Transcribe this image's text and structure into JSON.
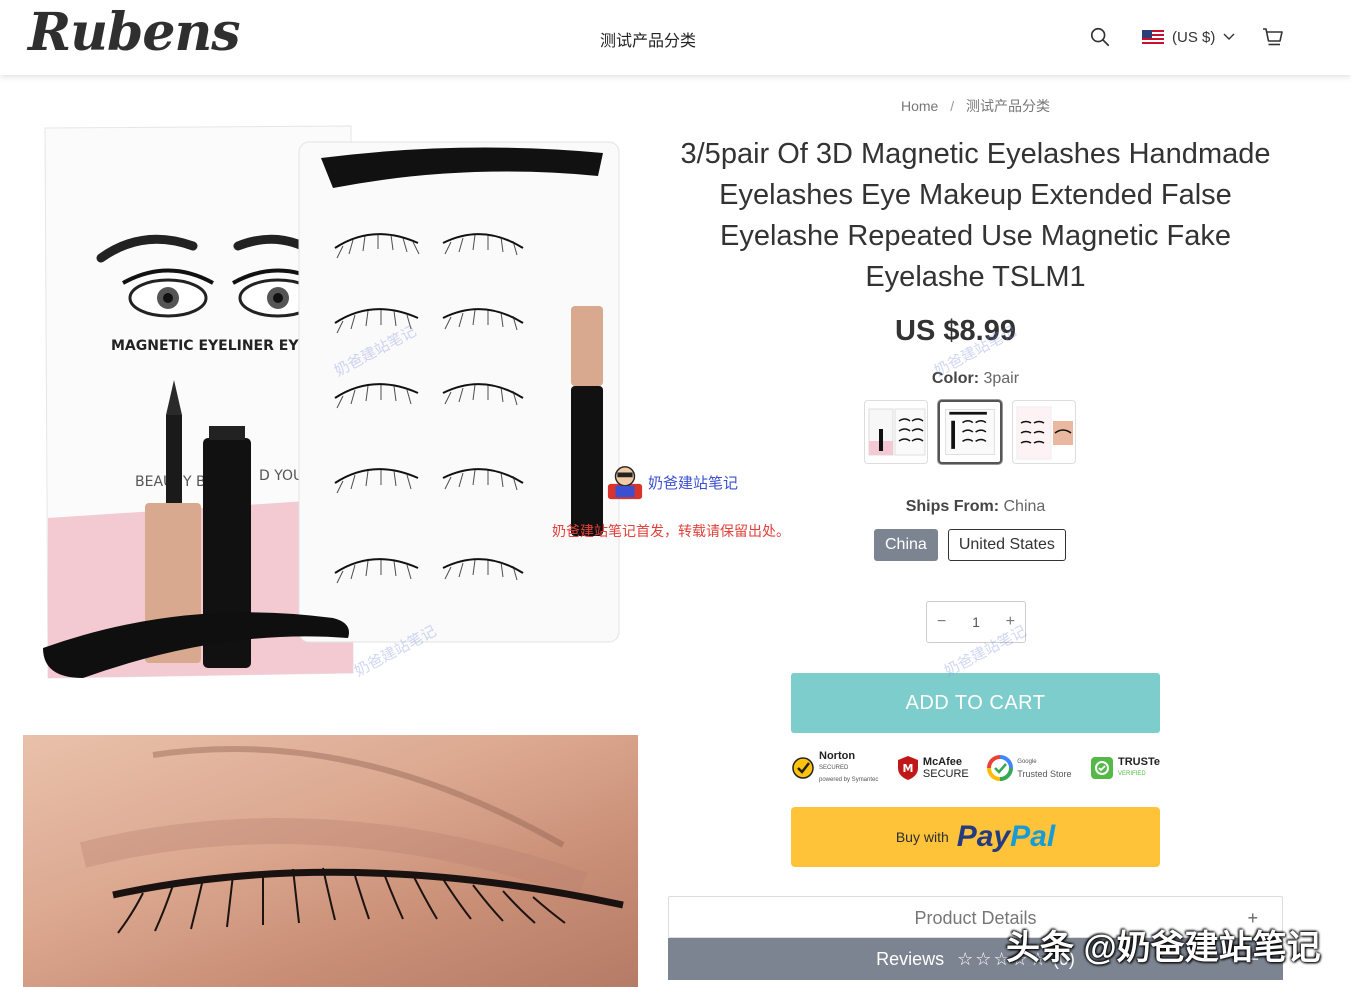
{
  "header": {
    "logo": "Rubens",
    "nav_category": "测试产品分类",
    "currency": "(US $)"
  },
  "breadcrumb": {
    "home": "Home",
    "sep": "/",
    "current": "测试产品分类"
  },
  "product": {
    "title": "3/5pair Of 3D Magnetic Eyelashes Handmade Eyelashes Eye Makeup Extended False Eyelashe Repeated Use Magnetic Fake Eyelashe TSLM1",
    "price": "US $8.99",
    "color_label": "Color:",
    "color_value": "3pair",
    "ships_label": "Ships From:",
    "ships_value": "China",
    "ship_options": [
      "China",
      "United States"
    ],
    "quantity": "1",
    "qty_minus": "−",
    "qty_plus": "+",
    "add_to_cart": "ADD TO CART",
    "paypal_buy_with": "Buy with",
    "paypal_a": "Pay",
    "paypal_b": "Pal",
    "product_details": "Product Details",
    "details_toggle": "+",
    "reviews": "Reviews",
    "review_stars": "☆☆☆☆☆",
    "review_count": "(0)",
    "review_toggle": "−"
  },
  "trust_badges": [
    {
      "name": "Norton",
      "sub": "SECURED",
      "sub2": "powered by Symantec"
    },
    {
      "name": "McAfee",
      "sub": "SECURE"
    },
    {
      "name": "Google",
      "sub": "Trusted Store"
    },
    {
      "name": "TRUSTe",
      "sub": "VERIFIED"
    }
  ],
  "product_image": {
    "box_text": "MAGNETIC EYELINER EYELASH SE",
    "box_tagline_a": "BEAU",
    "box_tagline_b": "Y BE",
    "box_tagline_c": "D YOU"
  },
  "watermark": {
    "site": "奶爸建站笔记",
    "caption": "奶爸建站笔记首发，转载请保留出处。",
    "bottom": "头条 @奶爸建站笔记"
  },
  "colors": {
    "accent": "#7dcdcc",
    "paypal": "#ffc33a",
    "active_option": "#7c8491"
  }
}
